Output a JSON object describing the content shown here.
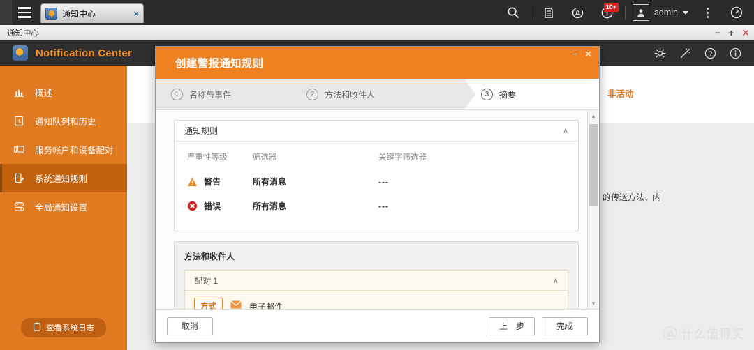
{
  "os_bar": {
    "menu_icon": "hamburger-icon",
    "tab": {
      "icon": "notification-bell-app-icon",
      "label": "通知中心",
      "close": "×"
    },
    "icons": [
      {
        "name": "search-icon",
        "glyph": "search"
      },
      {
        "name": "file-manager-icon",
        "glyph": "files"
      },
      {
        "name": "notification-sync-icon",
        "glyph": "bell-sync"
      },
      {
        "name": "info-icon",
        "glyph": "info",
        "badge": "10+"
      }
    ],
    "user": {
      "avatar": "user-avatar-icon",
      "name": "admin",
      "caret": "▾"
    },
    "kebab": "more-options-icon",
    "dashboard": "dashboard-gauge-icon"
  },
  "crumb": {
    "text": "通知中心",
    "minimize": "−",
    "maximize": "+",
    "close": "✕"
  },
  "app_header": {
    "logo": "notification-center-logo",
    "title": "Notification Center",
    "icons": [
      {
        "name": "settings-gear-icon",
        "glyph": "gear"
      },
      {
        "name": "wizard-wand-icon",
        "glyph": "wand"
      },
      {
        "name": "help-icon",
        "glyph": "?"
      },
      {
        "name": "about-info-icon",
        "glyph": "i"
      }
    ]
  },
  "sidebar": {
    "items": [
      {
        "label": "概述",
        "icon": "chart-overview-icon",
        "active": false
      },
      {
        "label": "通知队列和历史",
        "icon": "queue-history-icon",
        "active": false
      },
      {
        "label": "服务帐户和设备配对",
        "icon": "device-pairing-icon",
        "active": false
      },
      {
        "label": "系统通知规则",
        "icon": "notification-rules-icon",
        "active": true
      },
      {
        "label": "全局通知设置",
        "icon": "global-settings-icon",
        "active": false
      }
    ],
    "button": {
      "label": "查看系统日志",
      "icon": "clipboard-log-icon"
    }
  },
  "content": {
    "status": "非活动",
    "fragment": "的传送方法、内"
  },
  "modal": {
    "title": "创建警报通知规则",
    "minimize": "−",
    "close": "✕",
    "steps": [
      {
        "num": "1",
        "label": "名称与事件",
        "active": false
      },
      {
        "num": "2",
        "label": "方法和收件人",
        "active": false
      },
      {
        "num": "3",
        "label": "摘要",
        "active": true
      }
    ],
    "rules_panel": {
      "title": "通知规则",
      "chevron": "∧",
      "columns": [
        "严重性等级",
        "筛选器",
        "关键字筛选器"
      ],
      "rows": [
        {
          "severity": "警告",
          "severity_icon": "warning-triangle-icon",
          "filter": "所有消息",
          "keyword": "---"
        },
        {
          "severity": "错误",
          "severity_icon": "error-circle-icon",
          "filter": "所有消息",
          "keyword": "---"
        }
      ]
    },
    "methods_panel": {
      "title": "方法和收件人",
      "pair": {
        "label": "配对 1",
        "chevron": "∧",
        "tag": "方式",
        "value": "电子邮件",
        "value_icon": "email-envelope-icon"
      }
    },
    "footer": {
      "cancel": "取消",
      "previous": "上一步",
      "finish": "完成"
    }
  },
  "watermark": {
    "mark": "值",
    "text": "什么值得买"
  },
  "colors": {
    "accent_orange": "#ef8121",
    "sidebar_orange": "#e07b22",
    "sidebar_active": "#c2620e",
    "badge_red": "#e02020",
    "warning": "#ee8b1d",
    "error": "#d32020",
    "status_text": "#e8711a"
  }
}
